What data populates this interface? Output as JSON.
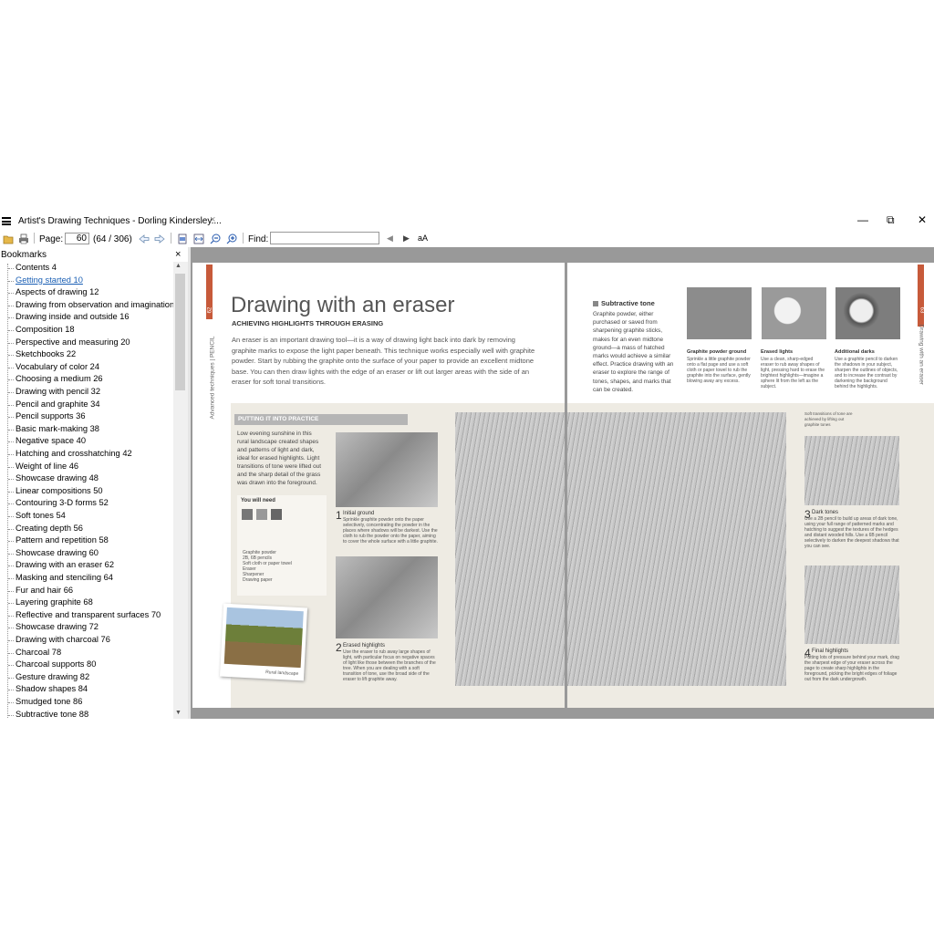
{
  "window": {
    "tab_title": "Artist's Drawing Techniques - Dorling Kindersley....",
    "tab_close": "×",
    "minimize": "—",
    "restore": "⧉",
    "close": "✕"
  },
  "toolbar": {
    "open_icon": "open-folder-icon",
    "print_icon": "print-icon",
    "page_label": "Page:",
    "page_value": "60",
    "page_count": "(64 / 306)",
    "back_icon": "back-arrow-icon",
    "forward_icon": "forward-arrow-icon",
    "fit_page_icon": "fit-page-icon",
    "fit_width_icon": "fit-width-icon",
    "zoom_out_icon": "zoom-out-icon",
    "zoom_in_icon": "zoom-in-icon",
    "find_label": "Find:",
    "find_value": "",
    "find_prev": "◀",
    "find_next": "▶",
    "match_case": "aΑ"
  },
  "bookmarks": {
    "title": "Bookmarks",
    "close": "×",
    "items": [
      "Contents 4",
      "Getting started 10",
      "Aspects of drawing 12",
      "Drawing from observation and imagination",
      "Drawing inside and outside 16",
      "Composition 18",
      "Perspective and measuring 20",
      "Sketchbooks 22",
      "Vocabulary of color 24",
      "Choosing a medium 26",
      "Drawing with pencil 32",
      "Pencil and graphite 34",
      "Pencil supports 36",
      "Basic mark-making 38",
      "Negative space 40",
      "Hatching and crosshatching 42",
      "Weight of line 46",
      "Showcase drawing 48",
      "Linear compositions 50",
      "Contouring 3-D forms 52",
      "Soft tones 54",
      "Creating depth 56",
      "Pattern and repetition 58",
      "Showcase drawing 60",
      "Drawing with an eraser 62",
      "Masking and stenciling 64",
      "Fur and hair 66",
      "Layering graphite 68",
      "Reflective and transparent surfaces 70",
      "Showcase drawing 72",
      "Drawing with charcoal 76",
      "Charcoal 78",
      "Charcoal supports 80",
      "Gesture drawing 82",
      "Shadow shapes 84",
      "Smudged tone 86",
      "Subtractive tone 88"
    ]
  },
  "page_left": {
    "page_number": "62",
    "side_label": "Advanced techniques | PENCIL",
    "title": "Drawing with an eraser",
    "subtitle": "ACHIEVING HIGHLIGHTS THROUGH ERASING",
    "intro": "An eraser is an important drawing tool—it is a way of drawing light back into dark by removing graphite marks to expose the light paper beneath. This technique works especially well with graphite powder. Start by rubbing the graphite onto the surface of your paper to provide an excellent midtone base. You can then draw lights with the edge of an eraser or lift out larger areas with the side of an eraser for soft tonal transitions.",
    "practice_heading": "PUTTING IT INTO PRACTICE",
    "practice_text": "Low evening sunshine in this rural landscape created shapes and patterns of light and dark, ideal for erased highlights. Light transitions of tone were lifted out and the sharp detail of the grass was drawn into the foreground.",
    "you_will_need": "You will need",
    "swatch_labels": [
      "Graphite powder",
      "2B pencil",
      "6B pencil"
    ],
    "materials": [
      "Graphite powder",
      "2B, 6B pencils",
      "Soft cloth or paper towel",
      "Eraser",
      "Sharpener",
      "Drawing paper"
    ],
    "photo_caption": "Rural landscape",
    "step1_num": "1",
    "step1_title": "Initial ground",
    "step1_text": "Sprinkle graphite powder onto the paper selectively, concentrating the powder in the places where shadows will be darkest. Use the cloth to rub the powder onto the paper, aiming to cover the whole surface with a little graphite.",
    "step2_num": "2",
    "step2_title": "Erased highlights",
    "step2_text": "Use the eraser to rub away large shapes of light, with particular focus on negative spaces of light like those between the branches of the tree. When you are dealing with a soft transition of tone, use the broad side of the eraser to lift graphite away."
  },
  "page_right": {
    "page_number": "63",
    "side_label": "Drawing with an eraser",
    "subtractive_heading": "Subtractive tone",
    "subtractive_text": "Graphite powder, either purchased or saved from sharpening graphite sticks, makes for an even midtone ground—a mass of hatched marks would achieve a similar effect. Practice drawing with an eraser to explore the range of tones, shapes, and marks that can be created.",
    "swatches": [
      {
        "title": "Graphite powder ground",
        "text": "Sprinkle a little graphite powder onto a flat page and use a soft cloth or paper towel to rub the graphite into the surface, gently blowing away any excess."
      },
      {
        "title": "Erased lights",
        "text": "Use a clean, sharp-edged eraser to rub away shapes of light, pressing hard to erase the brightest highlights—imagine a sphere lit from the left as the subject."
      },
      {
        "title": "Additional darks",
        "text": "Use a graphite pencil to darken the shadows in your subject, sharpen the outlines of objects, and to increase the contrast by darkening the background behind the highlights."
      }
    ],
    "callout": "Soft transitions of tone are achieved by lifting out graphite tones",
    "step3_num": "3",
    "step3_title": "Dark tones",
    "step3_text": "Use a 2B pencil to build up areas of dark tone, using your full range of patterned marks and hatching to suggest the textures of the hedges and distant wooded hills. Use a 6B pencil selectively to darken the deepest shadows that you can see.",
    "step4_num": "4",
    "step4_title": "Final highlights",
    "step4_text": "Putting lots of pressure behind your mark, drag the sharpest edge of your eraser across the page to create sharp highlights in the foreground, picking the bright edges of foliage out from the dark undergrowth."
  }
}
